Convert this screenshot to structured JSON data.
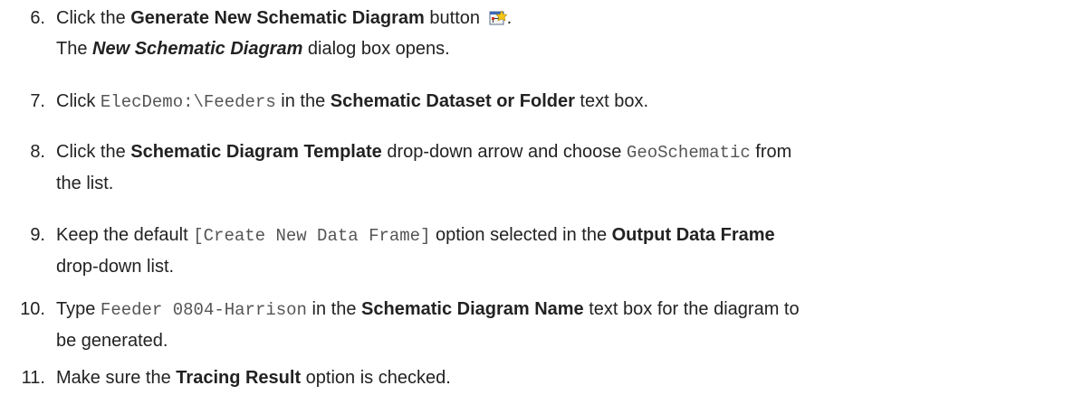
{
  "steps": [
    {
      "number": "6.",
      "line1": {
        "t1": "Click the ",
        "b1": "Generate New Schematic Diagram",
        "t2": " button ",
        "icon": "generate-schematic-icon",
        "t3": "."
      },
      "line2": {
        "t1": "The ",
        "bi": "New Schematic Diagram",
        "t2": " dialog box opens."
      }
    },
    {
      "number": "7.",
      "line1": {
        "t1": "Click ",
        "code": "ElecDemo:\\Feeders",
        "t2": " in the ",
        "b1": "Schematic Dataset or Folder",
        "t3": " text box."
      }
    },
    {
      "number": "8.",
      "line1": {
        "t1": "Click the ",
        "b1": "Schematic Diagram Template",
        "t2": " drop-down arrow and choose ",
        "code": "GeoSchematic",
        "t3": " from"
      },
      "line2": {
        "t1": "the list."
      }
    },
    {
      "number": "9.",
      "line1": {
        "t1": "Keep the default ",
        "code": "[Create New Data Frame]",
        "t2": " option selected in the ",
        "b1": "Output Data Frame"
      },
      "line2": {
        "t1": "drop-down list."
      }
    },
    {
      "number": "10.",
      "line1": {
        "t1": "Type ",
        "code": "Feeder 0804-Harrison",
        "t2": " in the ",
        "b1": "Schematic Diagram Name",
        "t3": " text box for the diagram to"
      },
      "line2": {
        "t1": "be generated."
      }
    },
    {
      "number": "11.",
      "line1": {
        "t1": "Make sure the ",
        "b1": "Tracing Result",
        "t2": " option is checked."
      }
    }
  ]
}
